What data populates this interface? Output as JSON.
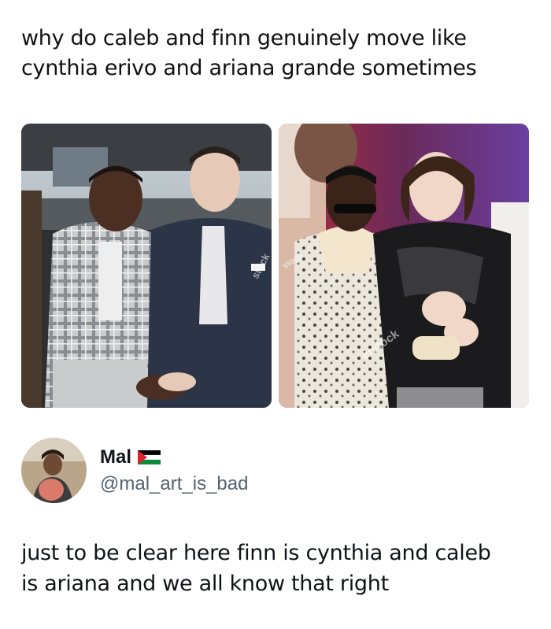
{
  "post": {
    "caption_line1": "why do caleb and finn genuinely move like",
    "caption_line2": "cynthia erivo and ariana grande sometimes",
    "photos": [
      {
        "watermark": "stock"
      },
      {
        "watermark": "erstock",
        "watermark_top": "stock"
      }
    ]
  },
  "reply": {
    "author_name": "Mal",
    "author_handle": "@mal_art_is_bad",
    "flag_icon": "palestine-flag-icon",
    "text_line1": "just to be clear here finn is cynthia and caleb",
    "text_line2": "is ariana and we all know that right"
  },
  "colors": {
    "text": "#0f1419",
    "handle": "#536471",
    "background": "#ffffff"
  }
}
